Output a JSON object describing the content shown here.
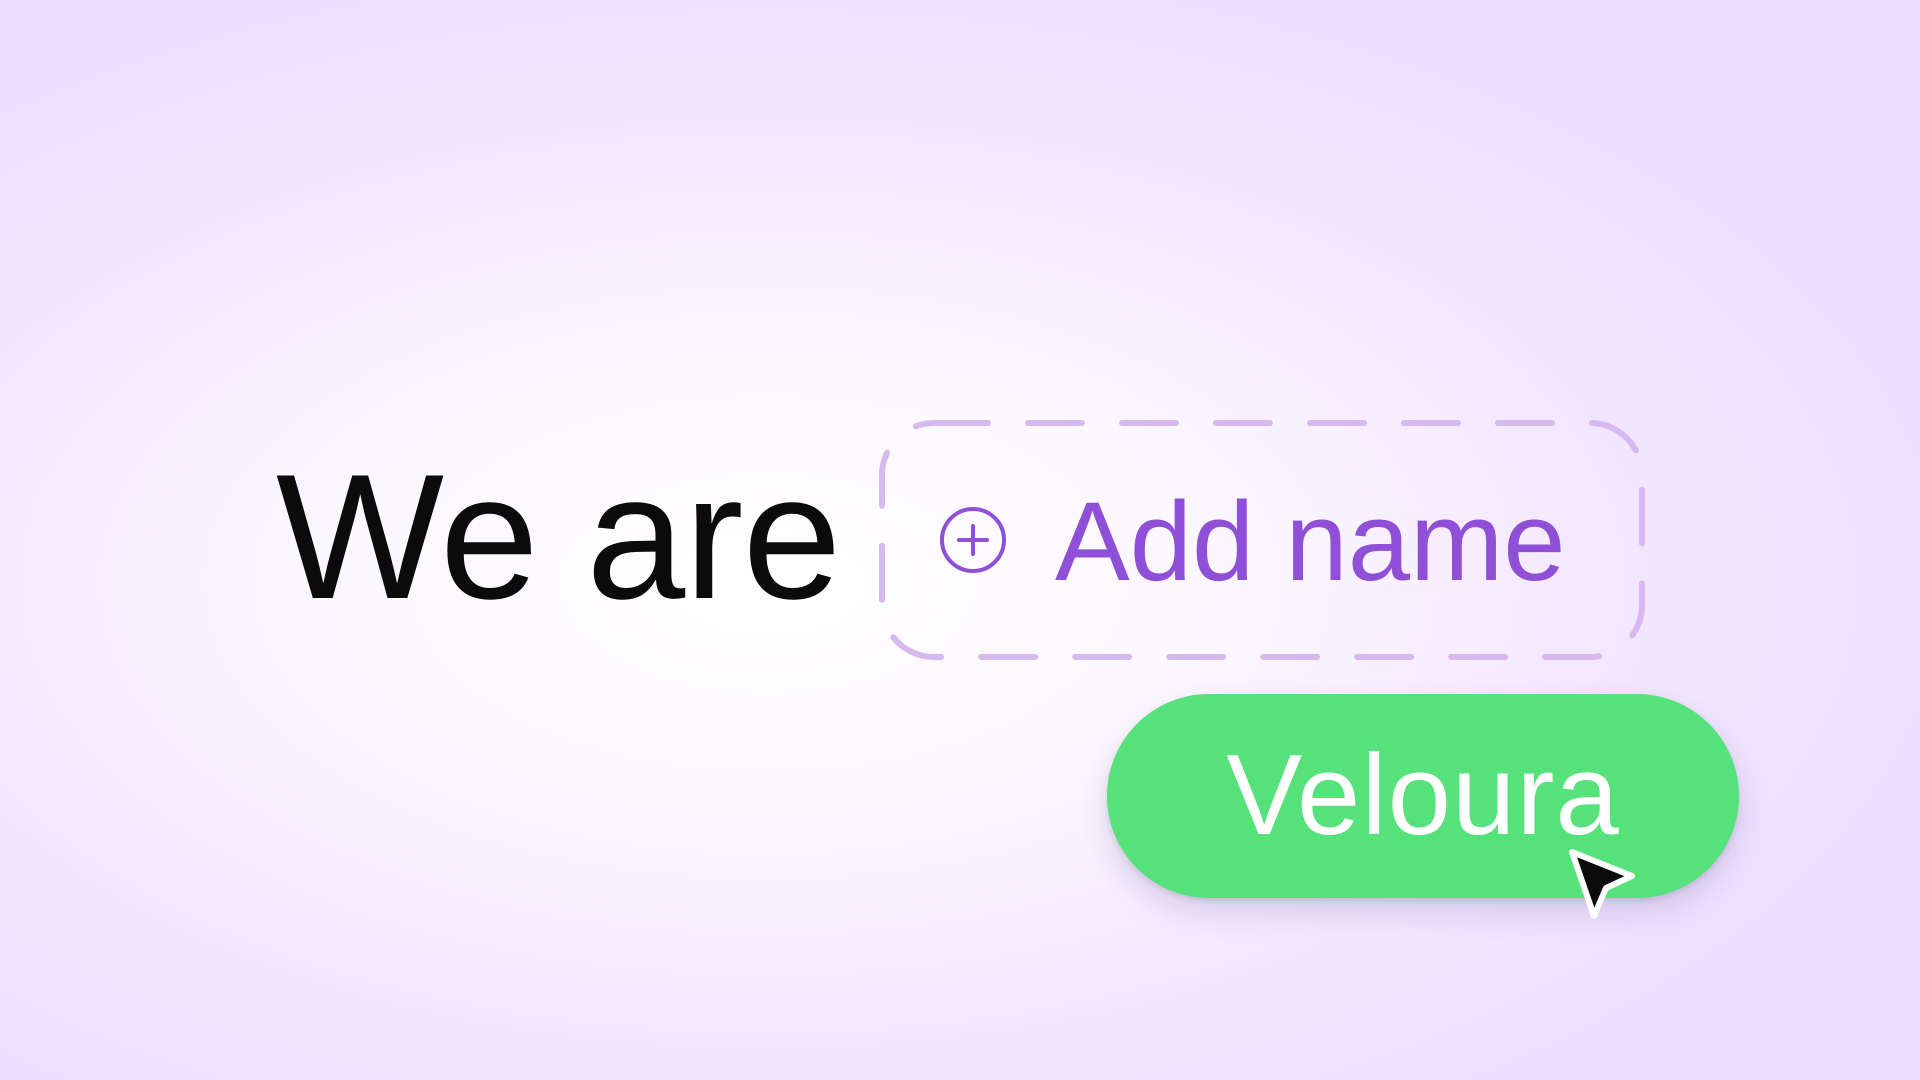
{
  "headline": {
    "text": "We are"
  },
  "name_slot": {
    "label": "Add name",
    "icon": "plus-circle-icon",
    "accent_color": "#8f4fd6",
    "border_color": "#d7b9ef"
  },
  "draggable_chip": {
    "label": "Veloura",
    "background_color": "#55e27a",
    "text_color": "#ffffff"
  },
  "pointer": {
    "icon": "arrow-cursor-icon"
  }
}
